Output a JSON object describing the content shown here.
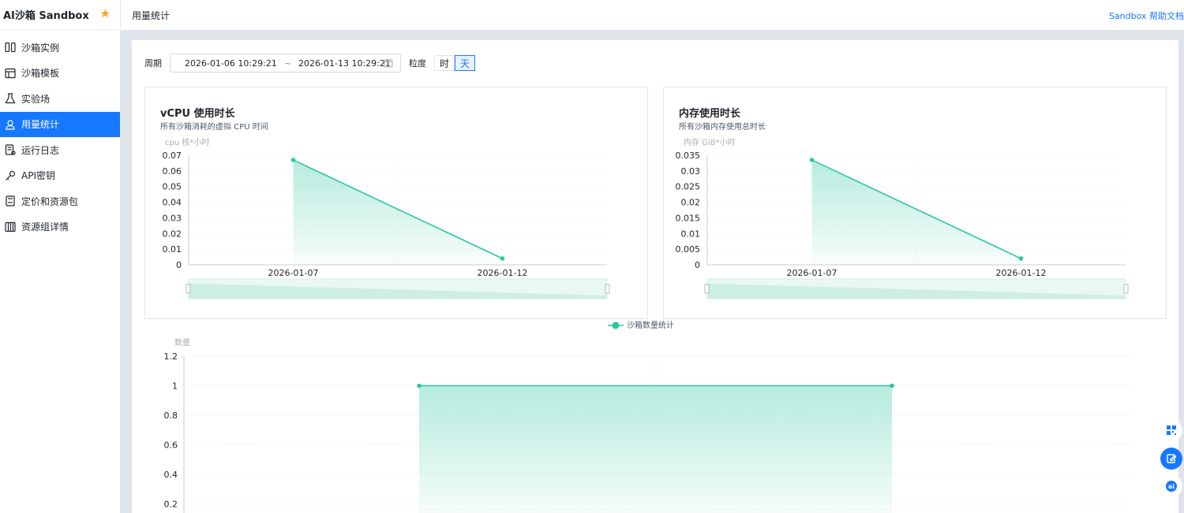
{
  "app": {
    "title": "AI沙箱 Sandbox"
  },
  "header": {
    "title": "用量统计",
    "help": "Sandbox 帮助文档"
  },
  "sidebar": {
    "items": [
      {
        "label": "沙箱实例",
        "icon": "columns-icon"
      },
      {
        "label": "沙箱模板",
        "icon": "layout-icon"
      },
      {
        "label": "实验场",
        "icon": "flask-icon"
      },
      {
        "label": "用量统计",
        "icon": "user-stats-icon",
        "active": true
      },
      {
        "label": "运行日志",
        "icon": "log-icon"
      },
      {
        "label": "API密钥",
        "icon": "key-icon"
      },
      {
        "label": "定价和资源包",
        "icon": "package-icon"
      },
      {
        "label": "资源组详情",
        "icon": "resource-group-icon"
      }
    ]
  },
  "filter": {
    "period_label": "周期",
    "start": "2026-01-06 10:29:21",
    "sep": "~",
    "end": "2026-01-13 10:29:21",
    "granularity_label": "粒度",
    "granularity_options": [
      "时",
      "天"
    ],
    "granularity_selected": "天"
  },
  "colors": {
    "accent": "#1677ff",
    "series": "#2ec7a0"
  },
  "chart_data": [
    {
      "type": "area",
      "title": "vCPU 使用时长",
      "subtitle": "所有沙箱消耗的虚拟 CPU 时间",
      "ylabel": "cpu 核*小时",
      "categories": [
        "2026-01-07",
        "2026-01-12"
      ],
      "values": [
        0.067,
        0.004
      ],
      "yticks": [
        "0",
        "0.01",
        "0.02",
        "0.03",
        "0.04",
        "0.05",
        "0.06",
        "0.07"
      ],
      "ylim": [
        0,
        0.07
      ],
      "grid": true
    },
    {
      "type": "area",
      "title": "内存使用时长",
      "subtitle": "所有沙箱内存使用总时长",
      "ylabel": "内存 GiB*小时",
      "categories": [
        "2026-01-07",
        "2026-01-12"
      ],
      "values": [
        0.0335,
        0.002
      ],
      "yticks": [
        "0",
        "0.005",
        "0.01",
        "0.015",
        "0.02",
        "0.025",
        "0.03",
        "0.035"
      ],
      "ylim": [
        0,
        0.035
      ],
      "grid": true
    },
    {
      "type": "area",
      "ylabel": "数量",
      "legend": [
        "沙箱数量统计"
      ],
      "series": [
        {
          "name": "沙箱数量统计",
          "values": [
            1,
            1
          ]
        }
      ],
      "yticks": [
        "0.2",
        "0.4",
        "0.6",
        "0.8",
        "1",
        "1.2"
      ],
      "ylim": [
        0,
        1.2
      ],
      "grid": true
    }
  ]
}
